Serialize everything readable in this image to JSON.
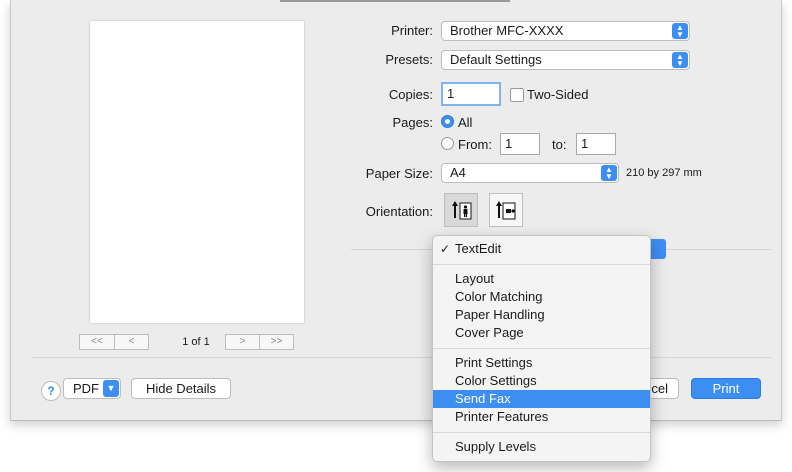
{
  "printer": {
    "label": "Printer:",
    "value": "Brother MFC-XXXX"
  },
  "presets": {
    "label": "Presets:",
    "value": "Default Settings"
  },
  "copies": {
    "label": "Copies:",
    "value": "1",
    "two_sided_label": "Two-Sided"
  },
  "pages": {
    "label": "Pages:",
    "all_label": "All",
    "from_label": "From:",
    "from_value": "1",
    "to_label": "to:",
    "to_value": "1"
  },
  "paper_size": {
    "label": "Paper Size:",
    "value": "A4",
    "dimensions": "210 by 297 mm"
  },
  "orientation": {
    "label": "Orientation:"
  },
  "preview": {
    "first_label": "<<",
    "prev_label": "<",
    "page_indicator": "1 of 1",
    "next_label": ">",
    "last_label": ">>"
  },
  "bottom": {
    "help_label": "?",
    "pdf_label": "PDF",
    "hide_details_label": "Hide Details",
    "cancel_partial_label": "cel",
    "print_label": "Print"
  },
  "menu": {
    "items": [
      "TextEdit",
      "Layout",
      "Color Matching",
      "Paper Handling",
      "Cover Page",
      "Print Settings",
      "Color Settings",
      "Send Fax",
      "Printer Features",
      "Supply Levels"
    ],
    "checked": "TextEdit",
    "highlighted": "Send Fax"
  },
  "colors": {
    "accent": "#3d8ef2",
    "background": "#ececec"
  },
  "icons": {
    "stepper": "up-down-chevron-icon",
    "check": "checkmark-icon",
    "portrait": "portrait-orientation-icon",
    "landscape": "landscape-orientation-icon"
  }
}
